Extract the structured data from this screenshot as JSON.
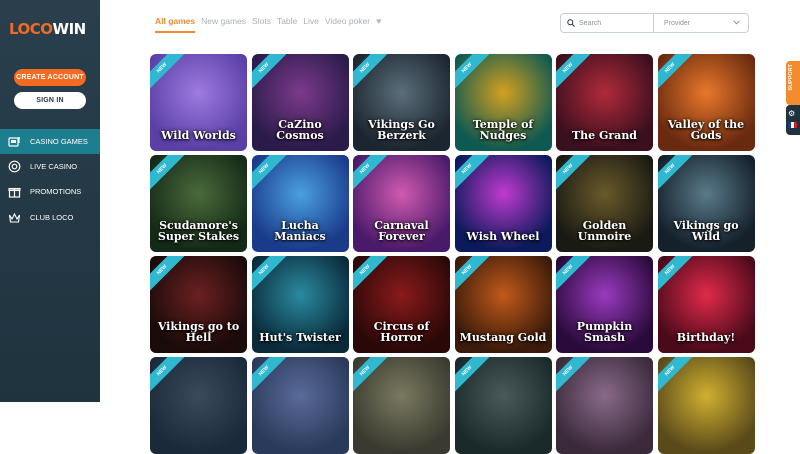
{
  "brand": {
    "logo_left": "LOCO",
    "logo_right": "WIN"
  },
  "auth": {
    "create_account": "CREATE ACCOUNT",
    "sign_in": "SIGN IN"
  },
  "nav": [
    {
      "label": "CASINO GAMES",
      "icon": "slot-machine-icon",
      "active": true
    },
    {
      "label": "LIVE CASINO",
      "icon": "chip-icon",
      "active": false
    },
    {
      "label": "PROMOTIONS",
      "icon": "gift-icon",
      "active": false
    },
    {
      "label": "CLUB LOCO",
      "icon": "crown-icon",
      "active": false
    }
  ],
  "tabs": [
    {
      "label": "All games",
      "active": true
    },
    {
      "label": "New games"
    },
    {
      "label": "Slots"
    },
    {
      "label": "Table"
    },
    {
      "label": "Live"
    },
    {
      "label": "Video poker"
    }
  ],
  "search": {
    "placeholder": "Search",
    "provider_placeholder": "Provider"
  },
  "side": {
    "support": "SUPPORT"
  },
  "new_badge": "NEW",
  "games": [
    {
      "title": "Wild Worlds",
      "colors": [
        "#5a3fa6",
        "#9d7be0"
      ]
    },
    {
      "title": "CaZino Cosmos",
      "colors": [
        "#2a1b4a",
        "#7c3a8c"
      ]
    },
    {
      "title": "Vikings Go Berzerk",
      "colors": [
        "#1c2630",
        "#5a6e7a"
      ]
    },
    {
      "title": "Temple of Nudges",
      "colors": [
        "#0f5a50",
        "#d4a020"
      ]
    },
    {
      "title": "The Grand",
      "colors": [
        "#3a0f1e",
        "#b02a3a"
      ]
    },
    {
      "title": "Valley of the Gods",
      "colors": [
        "#6a2a10",
        "#e8782a"
      ]
    },
    {
      "title": "Scudamore's Super Stakes",
      "colors": [
        "#142a18",
        "#4a6a3a"
      ]
    },
    {
      "title": "Lucha Maniacs",
      "colors": [
        "#1a3a8a",
        "#4aa0e0"
      ]
    },
    {
      "title": "Carnaval Forever",
      "colors": [
        "#4a1a6a",
        "#d05ab0"
      ]
    },
    {
      "title": "Wish Wheel",
      "colors": [
        "#0a1a5a",
        "#c03ad0"
      ]
    },
    {
      "title": "Golden Unmoire",
      "colors": [
        "#1a1a14",
        "#6a5a2a"
      ]
    },
    {
      "title": "Vikings go Wild",
      "colors": [
        "#14202a",
        "#5a7a8a"
      ]
    },
    {
      "title": "Vikings go to Hell",
      "colors": [
        "#1a0a0a",
        "#6a2020"
      ]
    },
    {
      "title": "Hut's Twister",
      "colors": [
        "#0a2a3a",
        "#2a8aa0"
      ]
    },
    {
      "title": "Circus of Horror",
      "colors": [
        "#2a0808",
        "#8a1a1a"
      ]
    },
    {
      "title": "Mustang Gold",
      "colors": [
        "#3a1a0a",
        "#c05a1a"
      ]
    },
    {
      "title": "Pumpkin Smash",
      "colors": [
        "#2a0a3a",
        "#9a3ac0"
      ]
    },
    {
      "title": "Birthday!",
      "colors": [
        "#4a0a1a",
        "#e02a4a"
      ]
    },
    {
      "title": "",
      "colors": [
        "#1a2a3a",
        "#3a4a5a"
      ]
    },
    {
      "title": "",
      "colors": [
        "#2a3a5a",
        "#5a6a9a"
      ]
    },
    {
      "title": "",
      "colors": [
        "#3a3a30",
        "#7a7a60"
      ]
    },
    {
      "title": "",
      "colors": [
        "#1a2a2a",
        "#4a5a5a"
      ]
    },
    {
      "title": "",
      "colors": [
        "#3a2a3a",
        "#8a6a8a"
      ]
    },
    {
      "title": "",
      "colors": [
        "#5a4a1a",
        "#d0b030"
      ]
    }
  ]
}
